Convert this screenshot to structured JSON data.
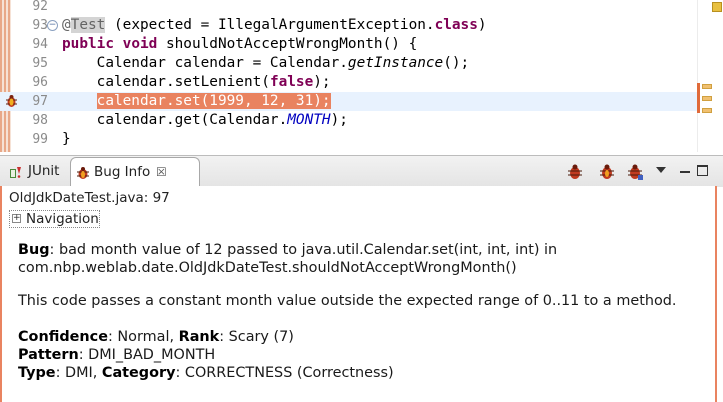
{
  "editor": {
    "lines": [
      {
        "num": "92"
      },
      {
        "num": "93"
      },
      {
        "num": "94"
      },
      {
        "num": "95"
      },
      {
        "num": "96"
      },
      {
        "num": "97"
      },
      {
        "num": "98"
      },
      {
        "num": "99"
      }
    ],
    "l93": {
      "at": "@",
      "annotation": "Test",
      "rest": " (expected = IllegalArgumentException.",
      "cls": "class",
      "close": ")"
    },
    "l94": {
      "k1": "public",
      "sp1": " ",
      "k2": "void",
      "rest": " shouldNotAcceptWrongMonth() {"
    },
    "l95": {
      "a": "    Calendar calendar = Calendar.",
      "b": "getInstance",
      "c": "();"
    },
    "l96": {
      "a": "    calendar.setLenient(",
      "b": "false",
      "c": ");"
    },
    "l97": {
      "indent": "    ",
      "sel": "calendar.set(1999, 12, 31);"
    },
    "l98": {
      "a": "    calendar.get(Calendar.",
      "b": "MONTH",
      "c": ");"
    },
    "l99": {
      "a": "}"
    }
  },
  "tabs": {
    "junit": "JUnit",
    "bug_info": "Bug Info",
    "close_glyph": "☒"
  },
  "bug": {
    "location": "OldJdkDateTest.java: 97",
    "navigation": "Navigation",
    "bug_label": "Bug",
    "bug_line1": ": bad month value of 12 passed to java.util.Calendar.set(int, int, int) in",
    "bug_line2": "com.nbp.weblab.date.OldJdkDateTest.shouldNotAcceptWrongMonth()",
    "description": "This code passes a constant month value outside the expected range of 0..11 to a method.",
    "confidence_label": "Confidence",
    "confidence_value": ": Normal, ",
    "rank_label": "Rank",
    "rank_value": ": Scary (7)",
    "pattern_label": "Pattern",
    "pattern_value": ": DMI_BAD_MONTH",
    "type_label": "Type",
    "type_value": ": DMI, ",
    "category_label": "Category",
    "category_value": ": CORRECTNESS (Correctness)"
  },
  "colors": {
    "selection": "#e98360",
    "keyword": "#7f0055",
    "constant": "#0000c0",
    "current_line": "#e8f2fe"
  },
  "icons": [
    "bug-gutter-icon",
    "junit-icon",
    "bug-info-icon",
    "bug-toolbar-icon",
    "view-menu-icon",
    "minimize-icon",
    "maximize-icon",
    "expand-plus-icon"
  ]
}
